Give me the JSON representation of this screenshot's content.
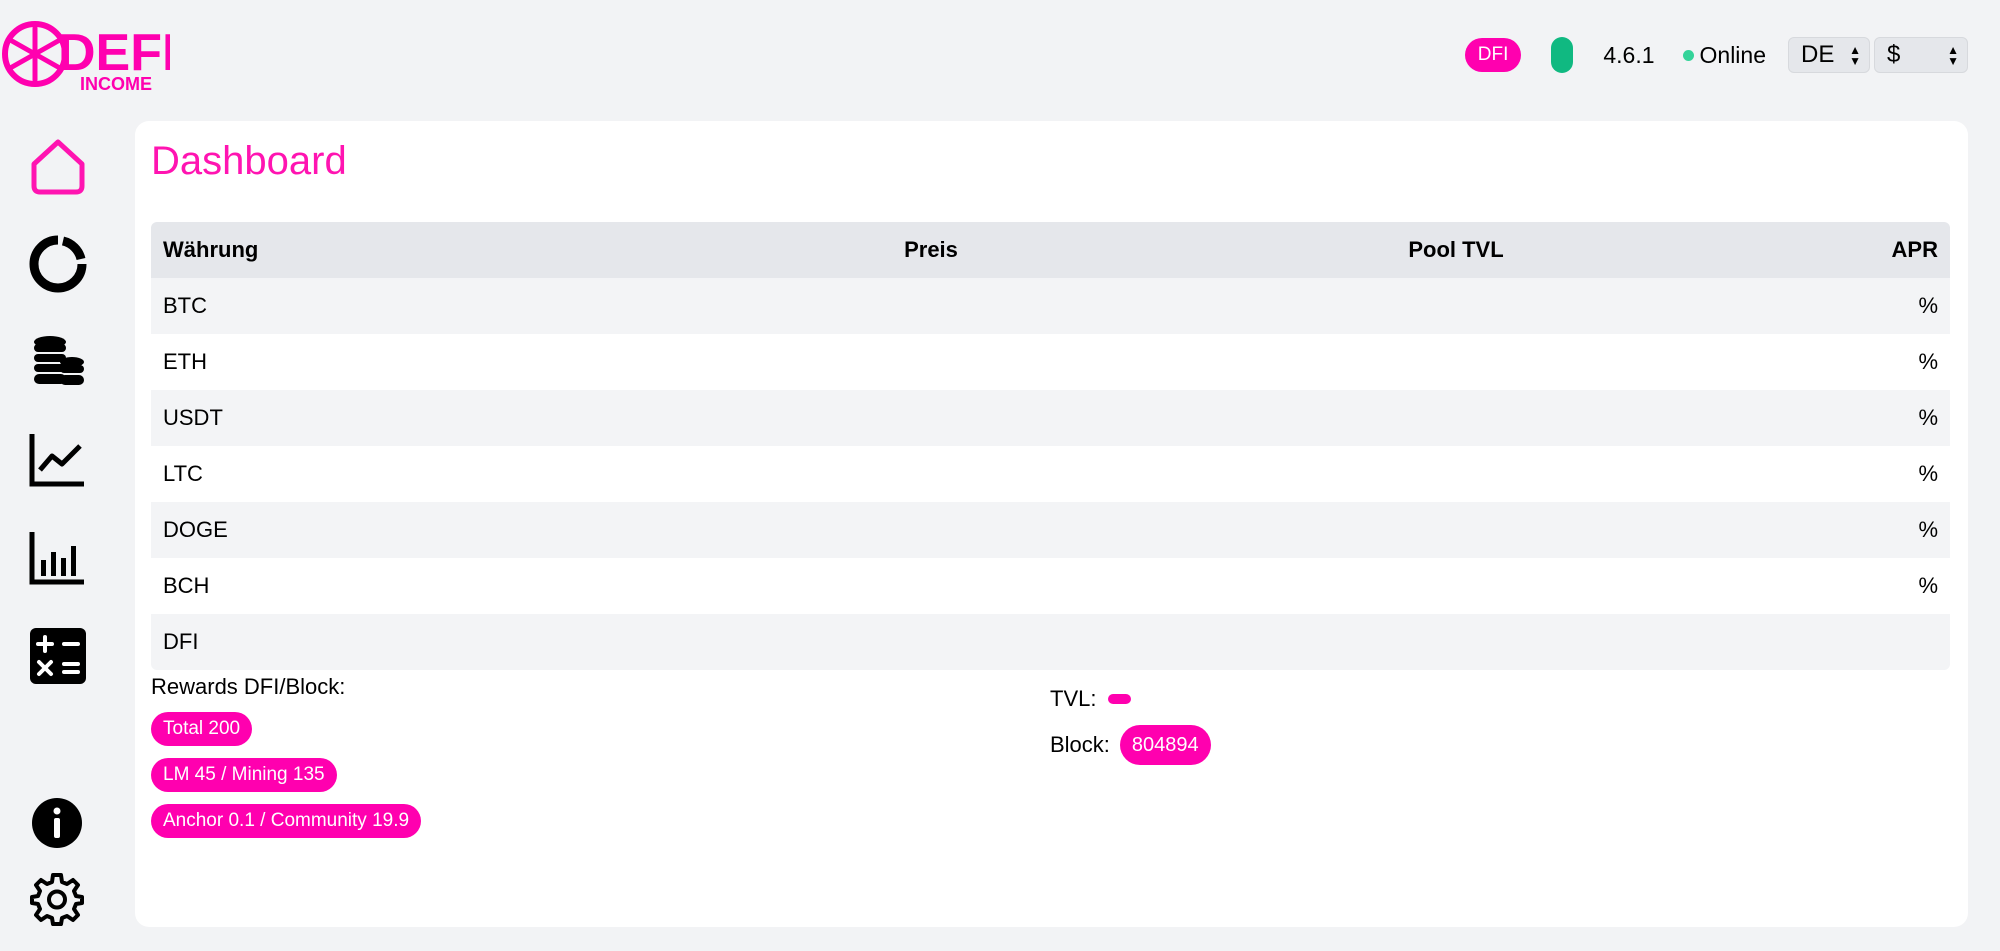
{
  "app": {
    "logo_text_main": "DEFI",
    "logo_text_sub": "INCOME",
    "brand_color": "#ff00af"
  },
  "header": {
    "token_badge": "DFI",
    "version": "4.6.1",
    "status": "Online",
    "language_select": "DE",
    "currency_select": "$"
  },
  "sidebar": {
    "items": [
      {
        "icon": "home-icon"
      },
      {
        "icon": "pie-chart-icon"
      },
      {
        "icon": "coins-stack-icon"
      },
      {
        "icon": "line-chart-icon"
      },
      {
        "icon": "bar-chart-icon"
      },
      {
        "icon": "calculator-icon"
      },
      {
        "icon": "info-icon"
      },
      {
        "icon": "gear-icon"
      }
    ]
  },
  "main": {
    "title": "Dashboard",
    "table": {
      "columns": [
        "Währung",
        "Preis",
        "Pool TVL",
        "APR"
      ],
      "rows": [
        {
          "currency": "BTC",
          "price": "",
          "tvl": "",
          "apr": "%"
        },
        {
          "currency": "ETH",
          "price": "",
          "tvl": "",
          "apr": "%"
        },
        {
          "currency": "USDT",
          "price": "",
          "tvl": "",
          "apr": "%"
        },
        {
          "currency": "LTC",
          "price": "",
          "tvl": "",
          "apr": "%"
        },
        {
          "currency": "DOGE",
          "price": "",
          "tvl": "",
          "apr": "%"
        },
        {
          "currency": "BCH",
          "price": "",
          "tvl": "",
          "apr": "%"
        },
        {
          "currency": "DFI",
          "price": "",
          "tvl": "",
          "apr": ""
        }
      ]
    },
    "rewards": {
      "label": "Rewards DFI/Block:",
      "pills": [
        "Total 200",
        "LM 45 / Mining 135",
        "Anchor 0.1 / Community 19.9"
      ]
    },
    "stats": {
      "tvl_label": "TVL:",
      "block_label": "Block:",
      "block_value": "804894"
    }
  }
}
